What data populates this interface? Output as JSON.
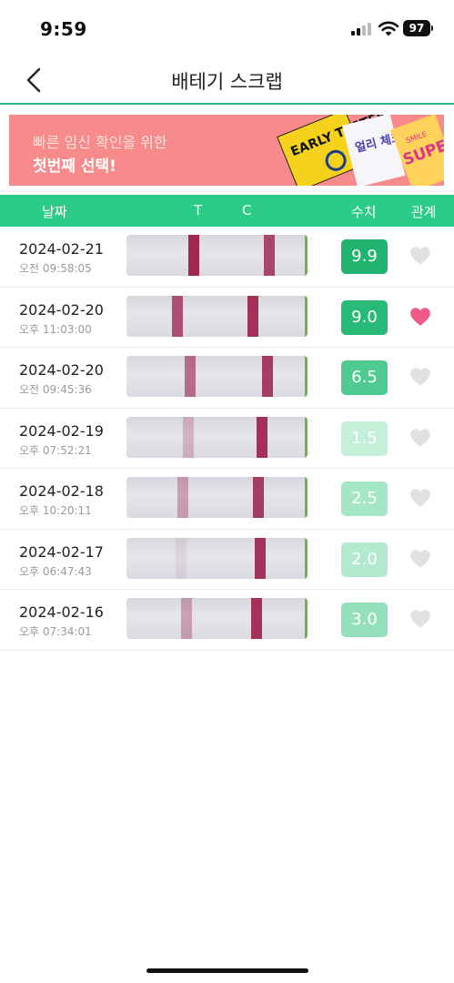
{
  "status_bar": {
    "time": "9:59",
    "battery": "97"
  },
  "header": {
    "title": "배테기 스크랩",
    "back_icon": "chevron-left-icon"
  },
  "banner": {
    "line1": "빠른 임신 확인을 위한",
    "line2": "첫번째 선택!",
    "art_text_1": "EARLY TESTER",
    "art_text_2": "얼리 체크",
    "art_text_3": "SUPER",
    "art_text_4": "SMILE"
  },
  "table_header": {
    "date": "날짜",
    "t": "T",
    "c": "C",
    "value": "수치",
    "interest": "관계"
  },
  "colors": {
    "accent": "#2dcb88",
    "heart_active": "#f05a86",
    "heart_inactive": "#e1e1e1",
    "strip_band": "#9c1f4a"
  },
  "rows": [
    {
      "date": "2024-02-21",
      "time": "오전 09:58:05",
      "value": "9.9",
      "badge_color": "#22b371",
      "liked": false,
      "t_pos": 0.37,
      "t_strength": 0.95,
      "c_pos": 0.79,
      "c_strength": 0.8
    },
    {
      "date": "2024-02-20",
      "time": "오후 11:03:00",
      "value": "9.0",
      "badge_color": "#28bb78",
      "liked": true,
      "t_pos": 0.28,
      "t_strength": 0.75,
      "c_pos": 0.7,
      "c_strength": 0.9
    },
    {
      "date": "2024-02-20",
      "time": "오전 09:45:36",
      "value": "6.5",
      "badge_color": "#4fcb92",
      "liked": false,
      "t_pos": 0.35,
      "t_strength": 0.6,
      "c_pos": 0.78,
      "c_strength": 0.85
    },
    {
      "date": "2024-02-19",
      "time": "오후 07:52:21",
      "value": "1.5",
      "badge_color": "#c4efd9",
      "liked": false,
      "t_pos": 0.34,
      "t_strength": 0.25,
      "c_pos": 0.75,
      "c_strength": 0.9
    },
    {
      "date": "2024-02-18",
      "time": "오후 10:20:11",
      "value": "2.5",
      "badge_color": "#a5e6c6",
      "liked": false,
      "t_pos": 0.31,
      "t_strength": 0.35,
      "c_pos": 0.73,
      "c_strength": 0.85
    },
    {
      "date": "2024-02-17",
      "time": "오후 06:47:43",
      "value": "2.0",
      "badge_color": "#b3e9ce",
      "liked": false,
      "t_pos": 0.3,
      "t_strength": 0.08,
      "c_pos": 0.74,
      "c_strength": 0.9
    },
    {
      "date": "2024-02-16",
      "time": "오후 07:34:01",
      "value": "3.0",
      "badge_color": "#95e0bc",
      "liked": false,
      "t_pos": 0.33,
      "t_strength": 0.35,
      "c_pos": 0.72,
      "c_strength": 0.9
    }
  ]
}
